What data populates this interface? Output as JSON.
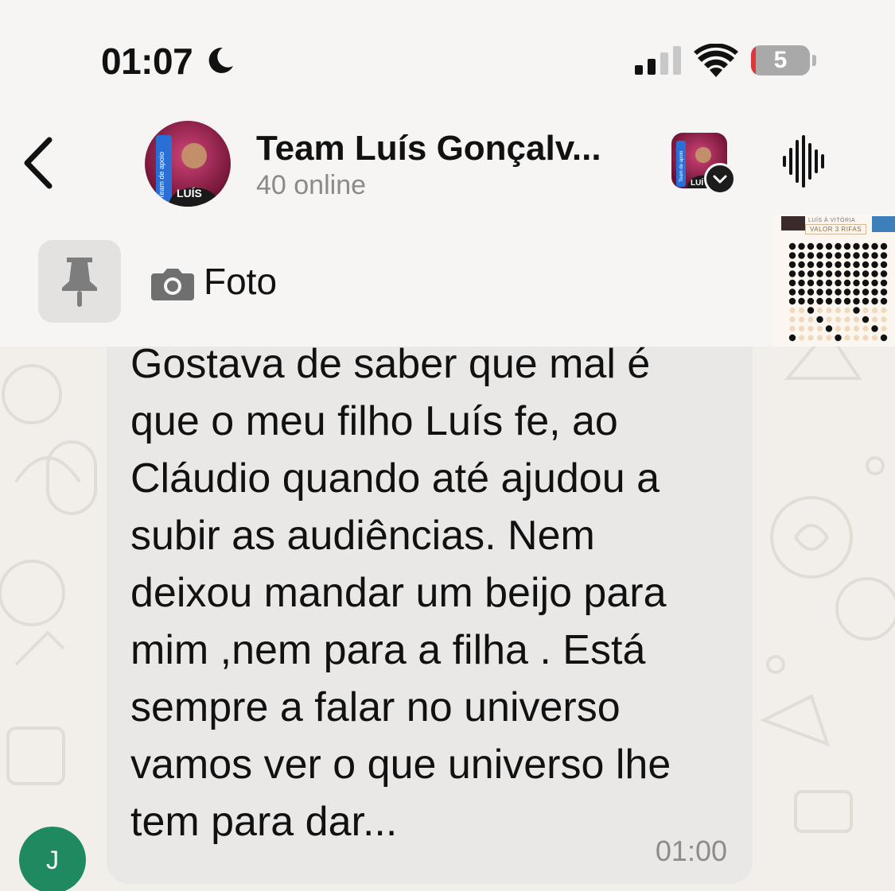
{
  "status_bar": {
    "time": "01:07",
    "battery_level": "5",
    "icons": [
      "moon-icon",
      "signal-icon",
      "wifi-icon",
      "battery-icon"
    ]
  },
  "header": {
    "back_icon": "chevron-left-icon",
    "group_name": "Team Luís Gonçalv...",
    "group_status": "40 online",
    "avatar_text_vertical": "Team de apoio",
    "avatar_text_name": "LUÍS",
    "small_avatar_text_vertical": "Team de apoio",
    "small_avatar_text_name": "LUÍ",
    "actions": [
      "chevron-down-icon",
      "waveform-icon"
    ]
  },
  "pinned": {
    "pin_icon": "pin-icon",
    "camera_icon": "camera-icon",
    "label": "Foto",
    "thumbnail_title": "LUÍS À VITÓRIA",
    "thumbnail_subtitle": "VALOR 3 RIFAS"
  },
  "message": {
    "text": "Gostava de saber que mal é\nque o meu filho Luís fe, ao\nCláudio quando até  ajudou a\nsubir as audiências. Nem\ndeixou mandar um beijo para\nmim ,nem para a filha . Está\nsempre a falar no universo\nvamos ver o que universo lhe\ntem para dar...",
    "time": "01:00",
    "sender_initial": "J"
  },
  "colors": {
    "header_bg": "#f6f5f3",
    "chat_bg": "#f2efea",
    "bubble_bg": "#e9e8e6",
    "sender_avatar": "#1f8a5f",
    "muted_text": "#8a8a8a"
  }
}
